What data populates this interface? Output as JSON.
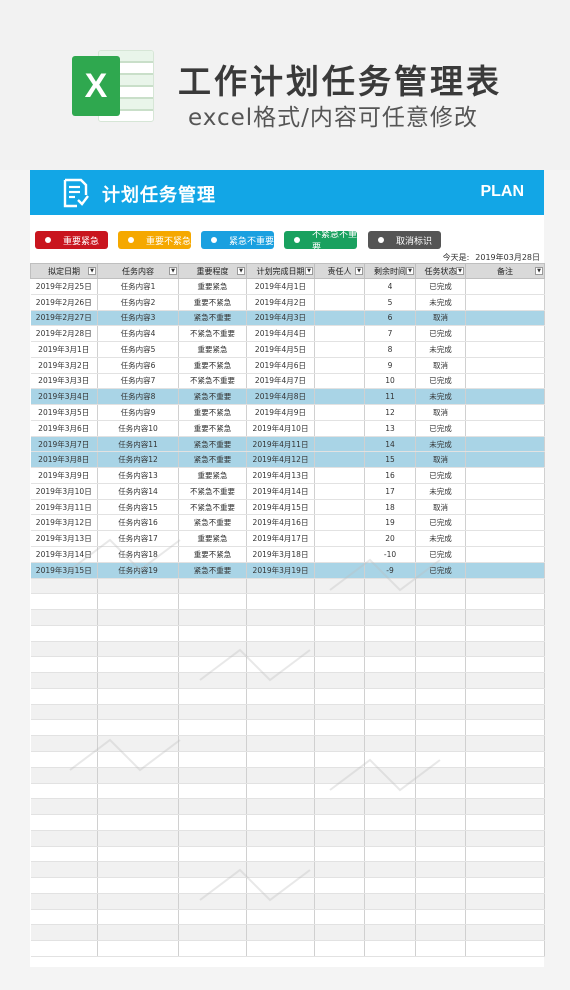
{
  "banner": {
    "title": "工作计划任务管理表",
    "subtitle": "excel格式/内容可任意修改",
    "excel_letter": "X"
  },
  "sheet": {
    "header_title": "计划任务管理",
    "plan_label": "PLAN",
    "header_color": "#12a6e6"
  },
  "legend": [
    {
      "label": "重要紧急",
      "color": "#c9151e"
    },
    {
      "label": "重要不紧急",
      "color": "#f5a800"
    },
    {
      "label": "紧急不重要",
      "color": "#1aa0e0"
    },
    {
      "label": "不紧急不重要",
      "color": "#19a15f"
    },
    {
      "label": "取消标识",
      "color": "#555555"
    }
  ],
  "today": {
    "label": "今天是:",
    "value": "2019年03月28日"
  },
  "columns": [
    "拟定日期",
    "任务内容",
    "重要程度",
    "计划完成日期",
    "责任人",
    "剩余时间",
    "任务状态",
    "备注"
  ],
  "rows": [
    [
      "2019年2月25日",
      "任务内容1",
      "重要紧急",
      "2019年4月1日",
      "",
      "4",
      "已完成",
      ""
    ],
    [
      "2019年2月26日",
      "任务内容2",
      "重要不紧急",
      "2019年4月2日",
      "",
      "5",
      "未完成",
      ""
    ],
    [
      "2019年2月27日",
      "任务内容3",
      "紧急不重要",
      "2019年4月3日",
      "",
      "6",
      "取消",
      ""
    ],
    [
      "2019年2月28日",
      "任务内容4",
      "不紧急不重要",
      "2019年4月4日",
      "",
      "7",
      "已完成",
      ""
    ],
    [
      "2019年3月1日",
      "任务内容5",
      "重要紧急",
      "2019年4月5日",
      "",
      "8",
      "未完成",
      ""
    ],
    [
      "2019年3月2日",
      "任务内容6",
      "重要不紧急",
      "2019年4月6日",
      "",
      "9",
      "取消",
      ""
    ],
    [
      "2019年3月3日",
      "任务内容7",
      "不紧急不重要",
      "2019年4月7日",
      "",
      "10",
      "已完成",
      ""
    ],
    [
      "2019年3月4日",
      "任务内容8",
      "紧急不重要",
      "2019年4月8日",
      "",
      "11",
      "未完成",
      ""
    ],
    [
      "2019年3月5日",
      "任务内容9",
      "重要不紧急",
      "2019年4月9日",
      "",
      "12",
      "取消",
      ""
    ],
    [
      "2019年3月6日",
      "任务内容10",
      "重要不紧急",
      "2019年4月10日",
      "",
      "13",
      "已完成",
      ""
    ],
    [
      "2019年3月7日",
      "任务内容11",
      "紧急不重要",
      "2019年4月11日",
      "",
      "14",
      "未完成",
      ""
    ],
    [
      "2019年3月8日",
      "任务内容12",
      "紧急不重要",
      "2019年4月12日",
      "",
      "15",
      "取消",
      ""
    ],
    [
      "2019年3月9日",
      "任务内容13",
      "重要紧急",
      "2019年4月13日",
      "",
      "16",
      "已完成",
      ""
    ],
    [
      "2019年3月10日",
      "任务内容14",
      "不紧急不重要",
      "2019年4月14日",
      "",
      "17",
      "未完成",
      ""
    ],
    [
      "2019年3月11日",
      "任务内容15",
      "不紧急不重要",
      "2019年4月15日",
      "",
      "18",
      "取消",
      ""
    ],
    [
      "2019年3月12日",
      "任务内容16",
      "紧急不重要",
      "2019年4月16日",
      "",
      "19",
      "已完成",
      ""
    ],
    [
      "2019年3月13日",
      "任务内容17",
      "重要紧急",
      "2019年4月17日",
      "",
      "20",
      "未完成",
      ""
    ],
    [
      "2019年3月14日",
      "任务内容18",
      "重要不紧急",
      "2019年3月18日",
      "",
      "-10",
      "已完成",
      ""
    ],
    [
      "2019年3月15日",
      "任务内容19",
      "紧急不重要",
      "2019年3月19日",
      "",
      "-9",
      "已完成",
      ""
    ]
  ],
  "highlighted_rows": [
    2,
    7,
    10,
    11,
    18
  ],
  "highlight_color": "#a9d4e6"
}
